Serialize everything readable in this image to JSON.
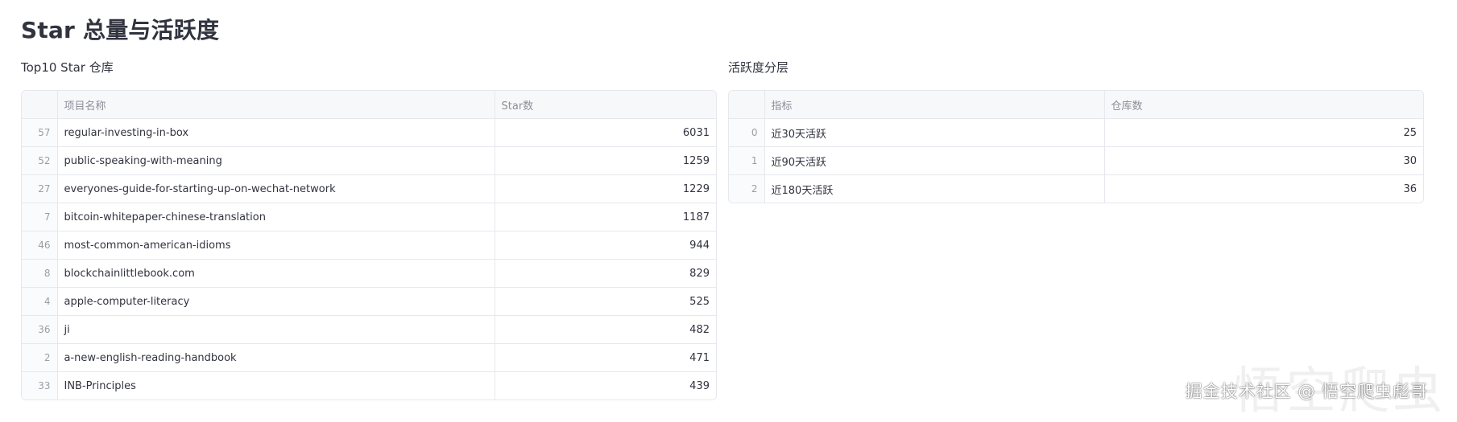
{
  "page": {
    "title": "Star 总量与活跃度"
  },
  "left_section": {
    "title": "Top10 Star 仓库",
    "columns": [
      "项目名称",
      "Star数"
    ],
    "rows": [
      {
        "index": "57",
        "name": "regular-investing-in-box",
        "stars": "6031"
      },
      {
        "index": "52",
        "name": "public-speaking-with-meaning",
        "stars": "1259"
      },
      {
        "index": "27",
        "name": "everyones-guide-for-starting-up-on-wechat-network",
        "stars": "1229"
      },
      {
        "index": "7",
        "name": "bitcoin-whitepaper-chinese-translation",
        "stars": "1187"
      },
      {
        "index": "46",
        "name": "most-common-american-idioms",
        "stars": "944"
      },
      {
        "index": "8",
        "name": "blockchainlittlebook.com",
        "stars": "829"
      },
      {
        "index": "4",
        "name": "apple-computer-literacy",
        "stars": "525"
      },
      {
        "index": "36",
        "name": "ji",
        "stars": "482"
      },
      {
        "index": "2",
        "name": "a-new-english-reading-handbook",
        "stars": "471"
      },
      {
        "index": "33",
        "name": "INB-Principles",
        "stars": "439"
      }
    ]
  },
  "right_section": {
    "title": "活跃度分层",
    "columns": [
      "指标",
      "仓库数"
    ],
    "rows": [
      {
        "index": "0",
        "metric": "近30天活跃",
        "count": "25"
      },
      {
        "index": "1",
        "metric": "近90天活跃",
        "count": "30"
      },
      {
        "index": "2",
        "metric": "近180天活跃",
        "count": "36"
      }
    ]
  },
  "watermark": {
    "text": "掘金技术社区 @ 悟空爬虫彪哥",
    "large_text": "悟空爬虫"
  }
}
